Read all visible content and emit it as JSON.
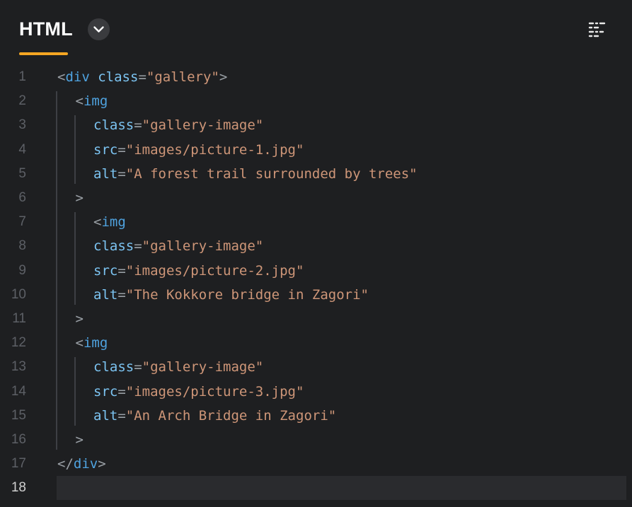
{
  "header": {
    "language": "HTML",
    "dropdown_icon": "chevron-down-icon",
    "format_icon": "format-lines-icon",
    "accent_color": "#f5a623"
  },
  "editor": {
    "current_line": 18,
    "lines": [
      {
        "num": "1",
        "indent": 0,
        "tokens": [
          [
            "punct",
            "<"
          ],
          [
            "tag",
            "div"
          ],
          [
            "text",
            " "
          ],
          [
            "attr",
            "class"
          ],
          [
            "eq",
            "="
          ],
          [
            "str",
            "\"gallery\""
          ],
          [
            "punct",
            ">"
          ]
        ]
      },
      {
        "num": "2",
        "indent": 1,
        "tokens": [
          [
            "punct",
            "<"
          ],
          [
            "tag",
            "img"
          ]
        ]
      },
      {
        "num": "3",
        "indent": 2,
        "tokens": [
          [
            "attr",
            "class"
          ],
          [
            "eq",
            "="
          ],
          [
            "str",
            "\"gallery-image\""
          ]
        ]
      },
      {
        "num": "4",
        "indent": 2,
        "tokens": [
          [
            "attr",
            "src"
          ],
          [
            "eq",
            "="
          ],
          [
            "str",
            "\"images/picture-1.jpg\""
          ]
        ]
      },
      {
        "num": "5",
        "indent": 2,
        "tokens": [
          [
            "attr",
            "alt"
          ],
          [
            "eq",
            "="
          ],
          [
            "str",
            "\"A forest trail surrounded by trees\""
          ]
        ]
      },
      {
        "num": "6",
        "indent": 1,
        "tokens": [
          [
            "punct",
            ">"
          ]
        ]
      },
      {
        "num": "7",
        "indent": 2,
        "tokens": [
          [
            "punct",
            "<"
          ],
          [
            "tag",
            "img"
          ]
        ]
      },
      {
        "num": "8",
        "indent": 2,
        "tokens": [
          [
            "attr",
            "class"
          ],
          [
            "eq",
            "="
          ],
          [
            "str",
            "\"gallery-image\""
          ]
        ]
      },
      {
        "num": "9",
        "indent": 2,
        "tokens": [
          [
            "attr",
            "src"
          ],
          [
            "eq",
            "="
          ],
          [
            "str",
            "\"images/picture-2.jpg\""
          ]
        ]
      },
      {
        "num": "10",
        "indent": 2,
        "tokens": [
          [
            "attr",
            "alt"
          ],
          [
            "eq",
            "="
          ],
          [
            "str",
            "\"The Kokkore bridge in Zagori\""
          ]
        ]
      },
      {
        "num": "11",
        "indent": 1,
        "tokens": [
          [
            "punct",
            ">"
          ]
        ]
      },
      {
        "num": "12",
        "indent": 1,
        "tokens": [
          [
            "punct",
            "<"
          ],
          [
            "tag",
            "img"
          ]
        ]
      },
      {
        "num": "13",
        "indent": 2,
        "tokens": [
          [
            "attr",
            "class"
          ],
          [
            "eq",
            "="
          ],
          [
            "str",
            "\"gallery-image\""
          ]
        ]
      },
      {
        "num": "14",
        "indent": 2,
        "tokens": [
          [
            "attr",
            "src"
          ],
          [
            "eq",
            "="
          ],
          [
            "str",
            "\"images/picture-3.jpg\""
          ]
        ]
      },
      {
        "num": "15",
        "indent": 2,
        "tokens": [
          [
            "attr",
            "alt"
          ],
          [
            "eq",
            "="
          ],
          [
            "str",
            "\"An Arch Bridge in Zagori\""
          ]
        ]
      },
      {
        "num": "16",
        "indent": 1,
        "tokens": [
          [
            "punct",
            ">"
          ]
        ]
      },
      {
        "num": "17",
        "indent": 0,
        "tokens": [
          [
            "punct",
            "</"
          ],
          [
            "tag",
            "div"
          ],
          [
            "punct",
            ">"
          ]
        ]
      },
      {
        "num": "18",
        "indent": 0,
        "tokens": []
      }
    ]
  }
}
